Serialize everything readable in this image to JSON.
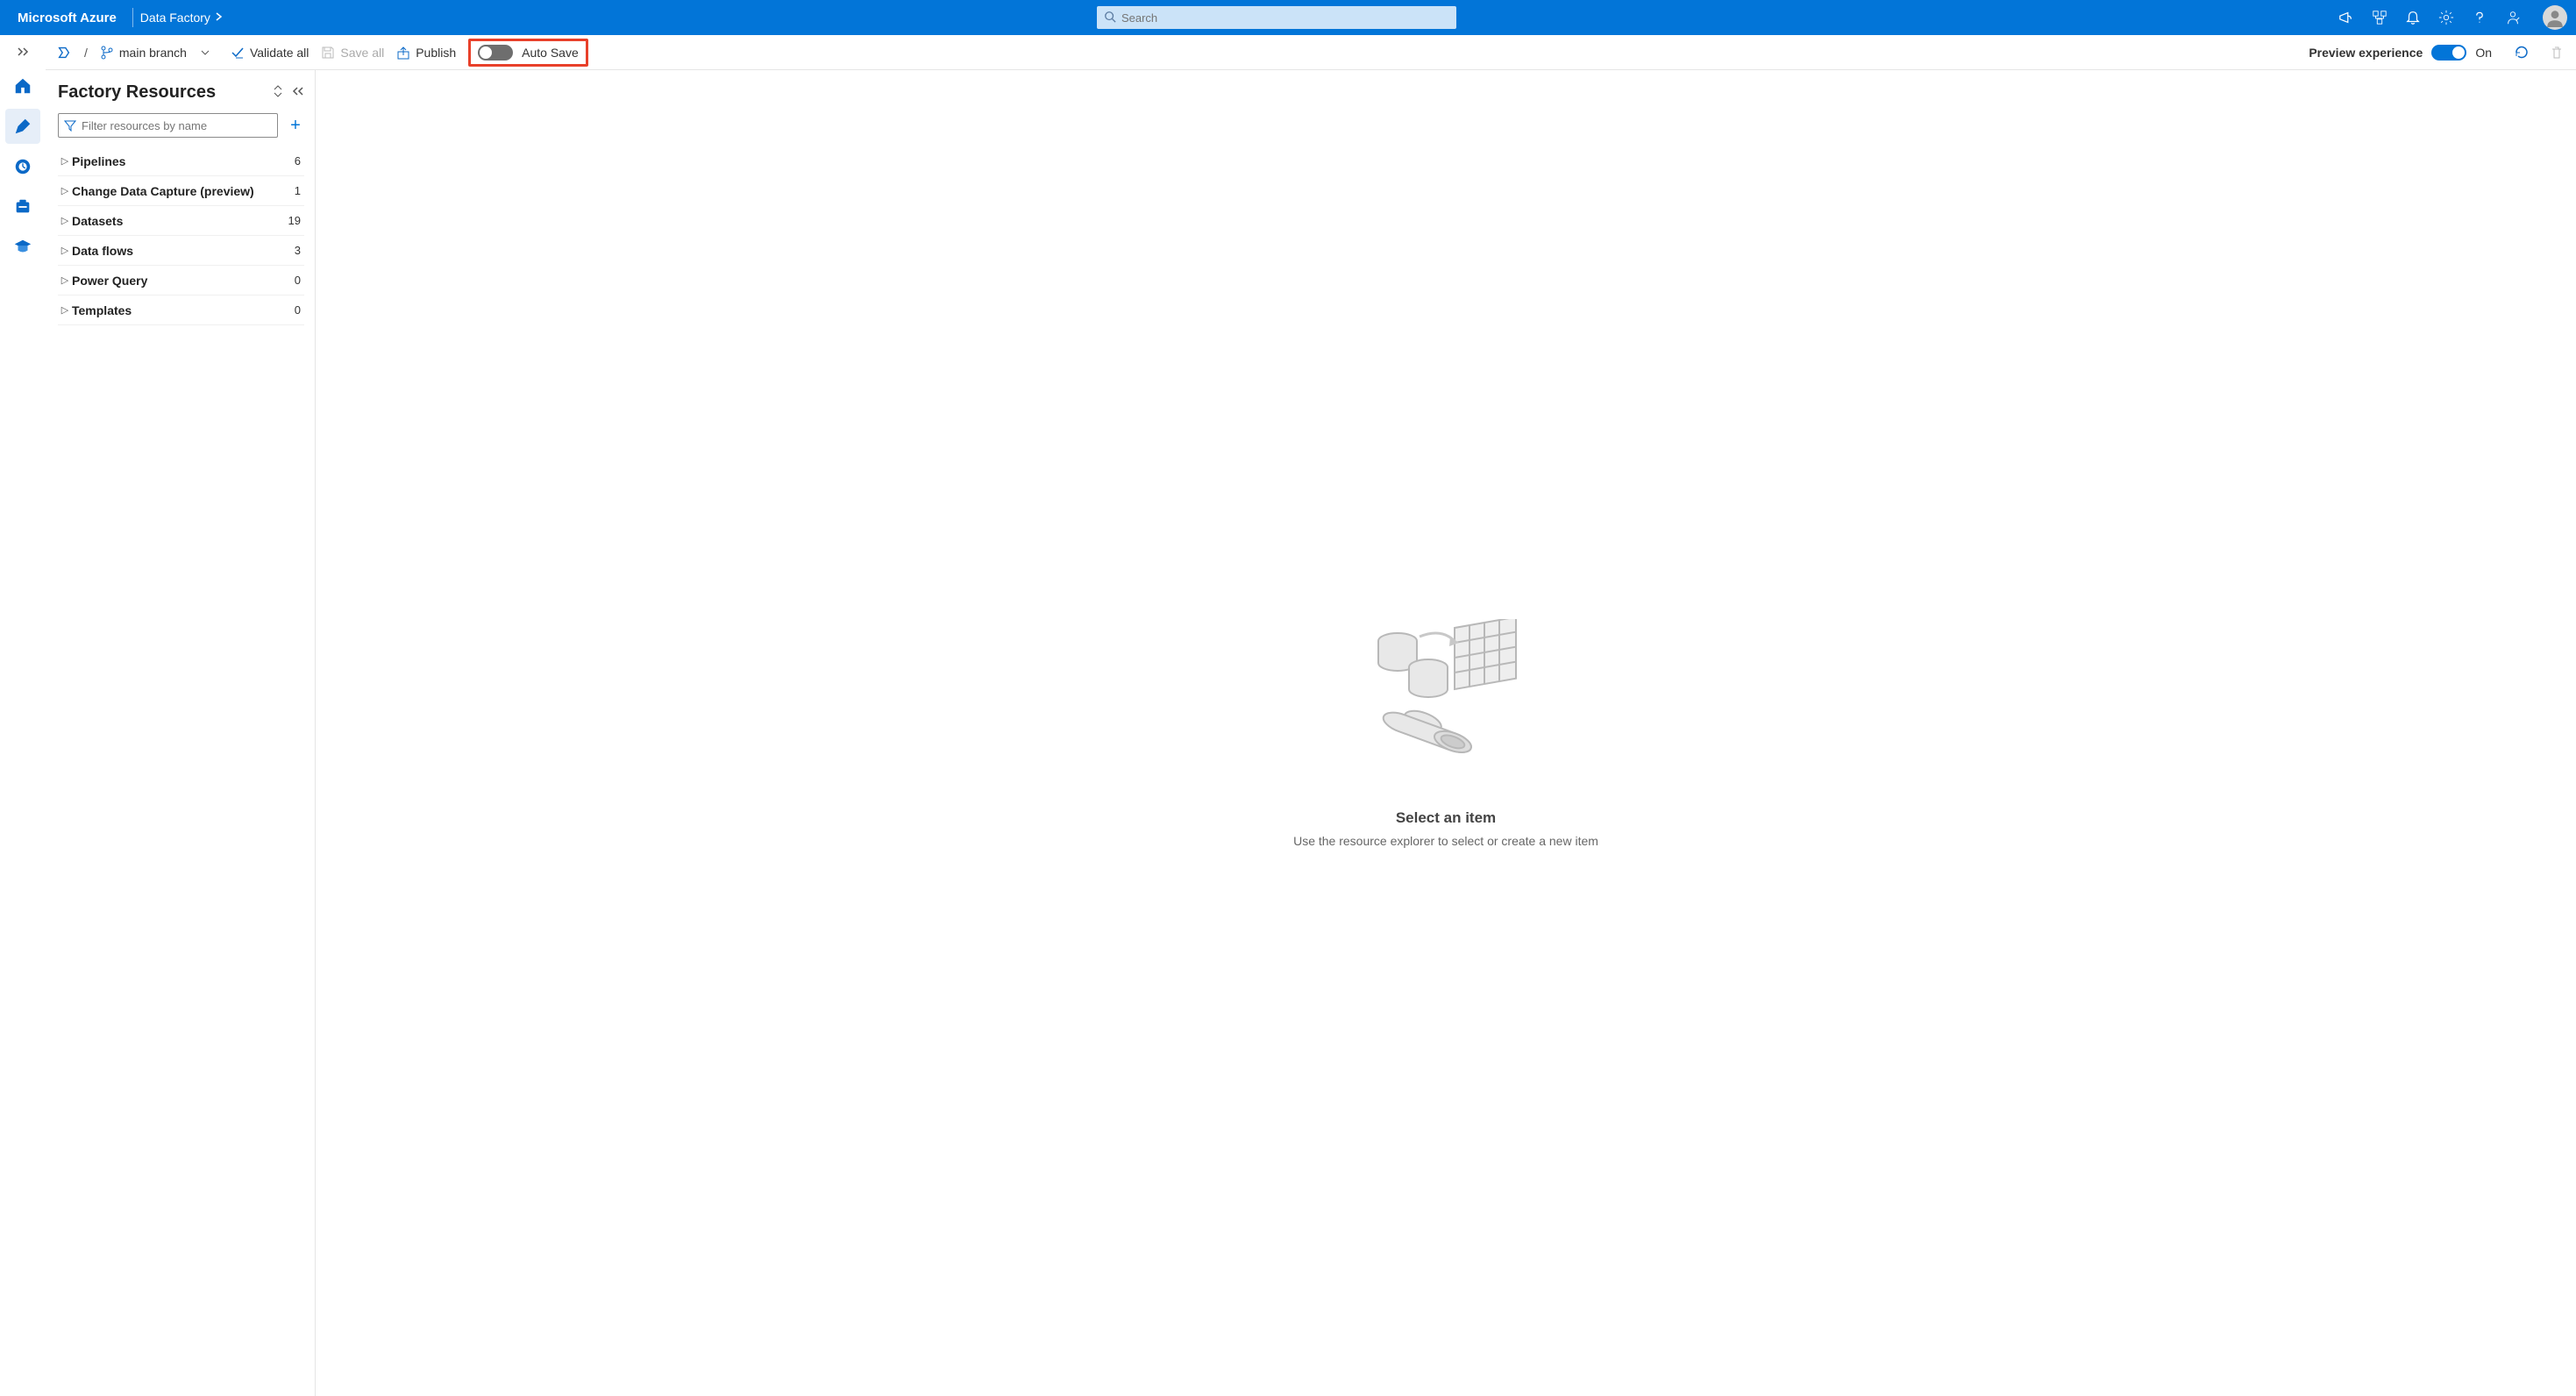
{
  "header": {
    "brand": "Microsoft Azure",
    "breadcrumb": "Data Factory",
    "search_placeholder": "Search"
  },
  "toolbar": {
    "branch": "main branch",
    "validate": "Validate all",
    "save": "Save all",
    "publish": "Publish",
    "autosave": "Auto Save",
    "preview_label": "Preview experience",
    "preview_state": "On"
  },
  "sidebar": {
    "title": "Factory Resources",
    "filter_placeholder": "Filter resources by name",
    "items": [
      {
        "label": "Pipelines",
        "count": "6"
      },
      {
        "label": "Change Data Capture (preview)",
        "count": "1"
      },
      {
        "label": "Datasets",
        "count": "19"
      },
      {
        "label": "Data flows",
        "count": "3"
      },
      {
        "label": "Power Query",
        "count": "0"
      },
      {
        "label": "Templates",
        "count": "0"
      }
    ]
  },
  "canvas": {
    "title": "Select an item",
    "subtitle": "Use the resource explorer to select or create a new item"
  }
}
